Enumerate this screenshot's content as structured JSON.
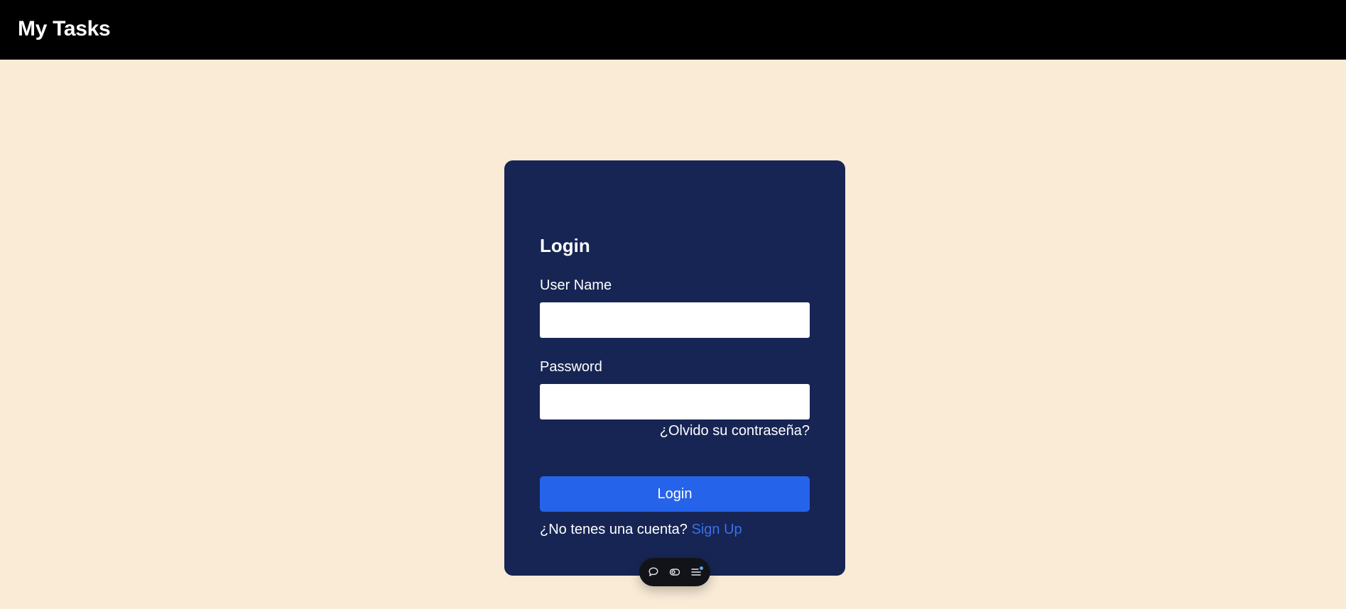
{
  "app": {
    "title": "My Tasks"
  },
  "login": {
    "title": "Login",
    "username_label": "User Name",
    "username_value": "",
    "password_label": "Password",
    "password_value": "",
    "forgot_link": "¿Olvido su contraseña?",
    "submit_label": "Login",
    "signup_prompt": "¿No tenes una cuenta?",
    "signup_link": "Sign Up"
  },
  "toolbar": {
    "items": [
      {
        "icon": "chat-bubble-icon"
      },
      {
        "icon": "toggle-eye-icon"
      },
      {
        "icon": "menu-list-icon"
      }
    ]
  },
  "colors": {
    "page_background": "#faebd7",
    "topbar": "#000000",
    "card": "#172554",
    "primary_button": "#2563eb",
    "link": "#3b6fe8"
  }
}
